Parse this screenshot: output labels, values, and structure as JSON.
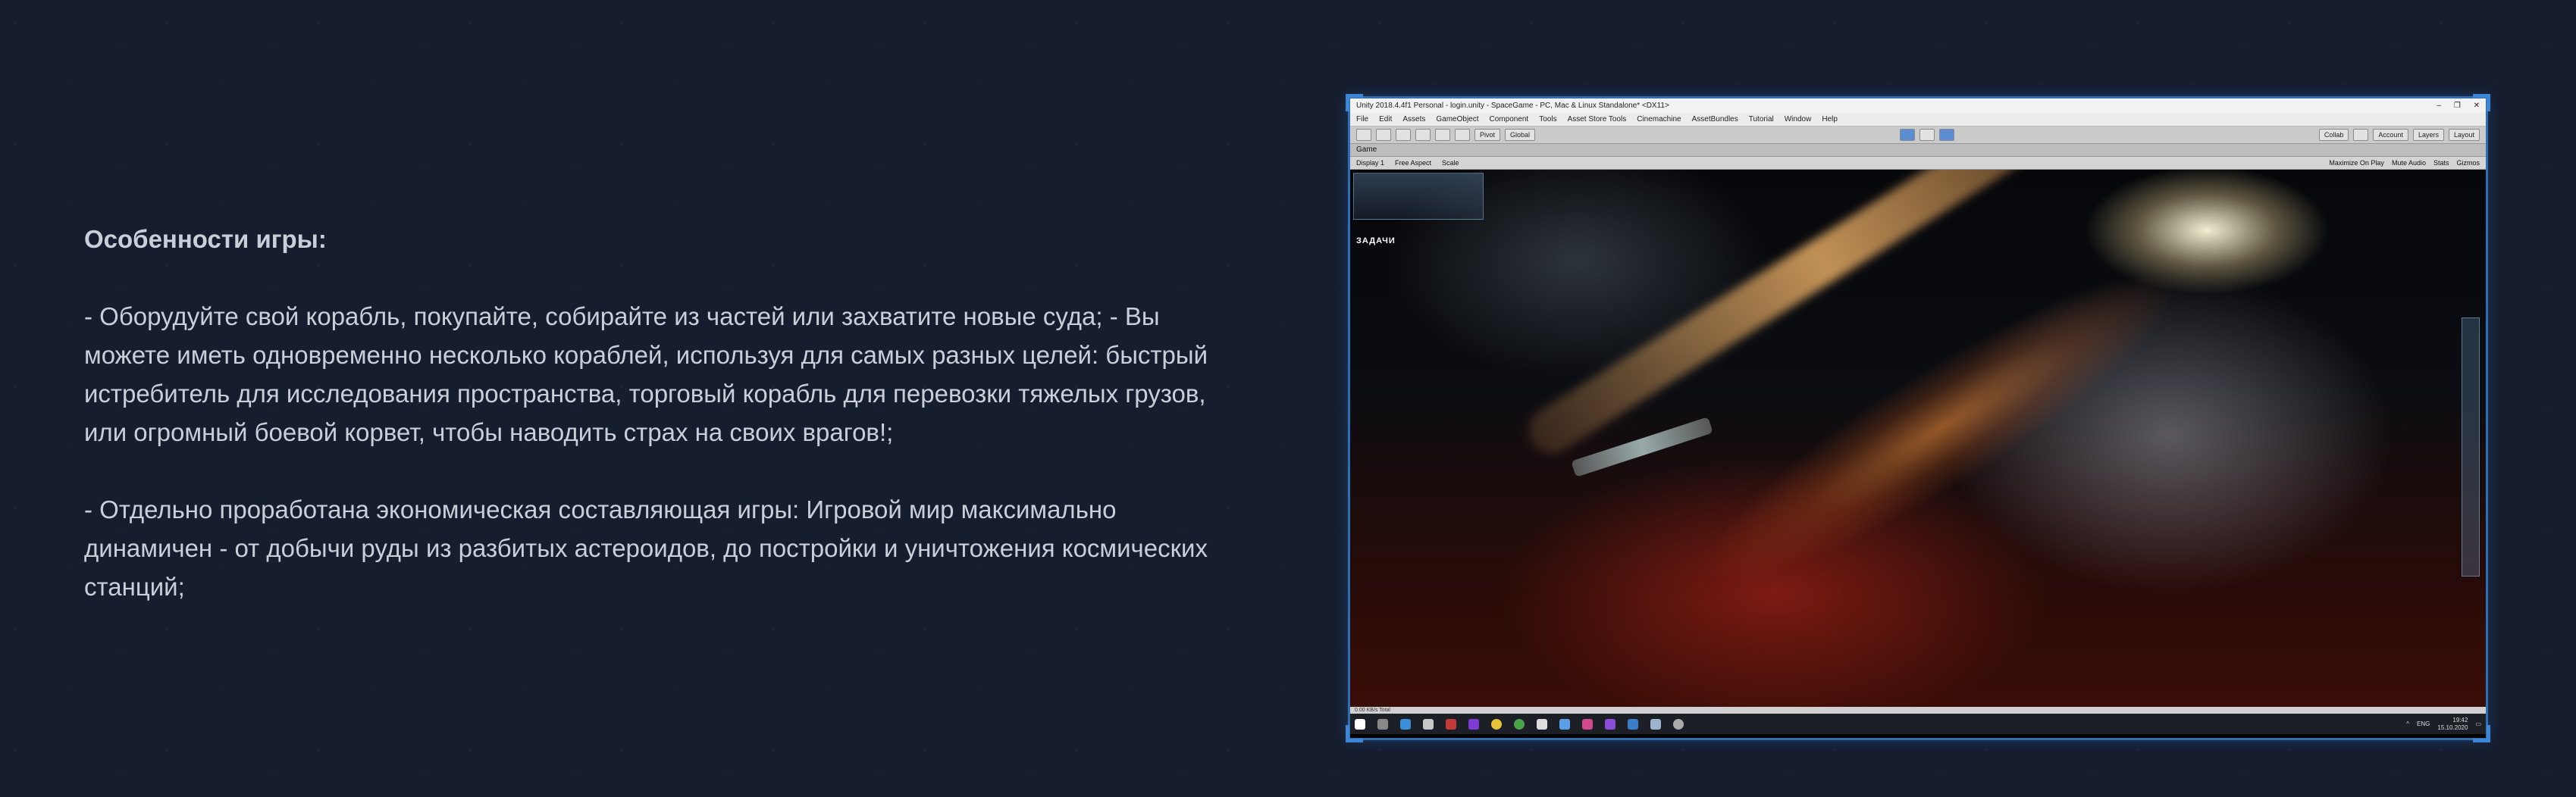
{
  "features": {
    "heading": "Особенности игры:",
    "paragraph_1": "- Оборудуйте свой корабль, покупайте, собирайте из частей или захватите новые суда; - Вы можете иметь одновременно несколько кораблей, используя для самых разных целей: быстрый истребитель для исследования пространства, торговый корабль для перевозки тяжелых грузов, или огромный боевой корвет, чтобы наводить страх на своих врагов!;",
    "paragraph_2": "- Отдельно проработана экономическая составляющая игры: Игровой мир максимально динамичен - от добычи руды из разбитых астероидов, до постройки и уничтожения космических станций;"
  },
  "screenshot": {
    "window_title": "Unity 2018.4.4f1 Personal - login.unity - SpaceGame - PC, Mac & Linux Standalone* <DX11>",
    "window_controls": [
      "–",
      "❐",
      "✕"
    ],
    "menu": [
      "File",
      "Edit",
      "Assets",
      "GameObject",
      "Component",
      "Tools",
      "Asset Store Tools",
      "Cinemachine",
      "AssetBundles",
      "Tutorial",
      "Window",
      "Help"
    ],
    "toolbar": {
      "pivot": "Pivot",
      "global": "Global",
      "collab": "Collab",
      "account": "Account",
      "layers": "Layers",
      "layout": "Layout"
    },
    "game_tab": "Game",
    "game_bar": {
      "display": "Display 1",
      "aspect": "Free Aspect",
      "scale": "Scale",
      "right": [
        "Maximize On Play",
        "Mute Audio",
        "Stats",
        "Gizmos"
      ]
    },
    "hud_logo": "ЗАДАЧИ",
    "status": "0.00 KB/s Total",
    "taskbar": {
      "lang": "ENG",
      "time": "19:42",
      "date": "15.10.2020"
    }
  }
}
